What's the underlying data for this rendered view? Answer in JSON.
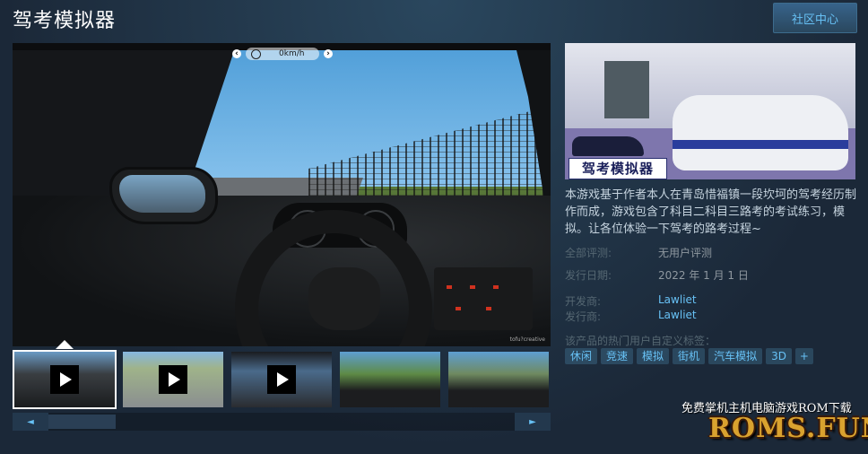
{
  "header": {
    "title": "驾考模拟器",
    "community_button": "社区中心"
  },
  "video": {
    "hud_speed": "0km/h",
    "hud_left_btn": "‹",
    "hud_right_btn": "›",
    "watermark": "tofu?creative"
  },
  "thumbnails": [
    {
      "type": "video",
      "selected": true
    },
    {
      "type": "video",
      "selected": false
    },
    {
      "type": "video",
      "selected": false
    },
    {
      "type": "image",
      "selected": false
    },
    {
      "type": "image",
      "selected": false
    }
  ],
  "scroll": {
    "left": "◄",
    "right": "►"
  },
  "capsule": {
    "title": "驾考模拟器"
  },
  "description": "本游戏基于作者本人在青岛惜福镇一段坎坷的驾考经历制作而成，游戏包含了科目二科目三路考的考试练习，模拟。让各位体验一下驾考的路考过程~",
  "info": {
    "reviews_label": "全部评测:",
    "reviews_value": "无用户评测",
    "release_label": "发行日期:",
    "release_value": "2022 年 1 月 1 日",
    "developer_label": "开发商:",
    "developer_value": "Lawliet",
    "publisher_label": "发行商:",
    "publisher_value": "Lawliet"
  },
  "tags_label": "该产品的热门用户自定义标签：",
  "tags": [
    "休闲",
    "竞速",
    "模拟",
    "街机",
    "汽车模拟",
    "3D",
    "+"
  ],
  "promo": {
    "line": "免费掌机主机电脑游戏ROM下载",
    "logo": "ROMS.FUN"
  },
  "colors": {
    "background": "#1b2838",
    "link": "#67c1f5",
    "label": "#556772"
  }
}
